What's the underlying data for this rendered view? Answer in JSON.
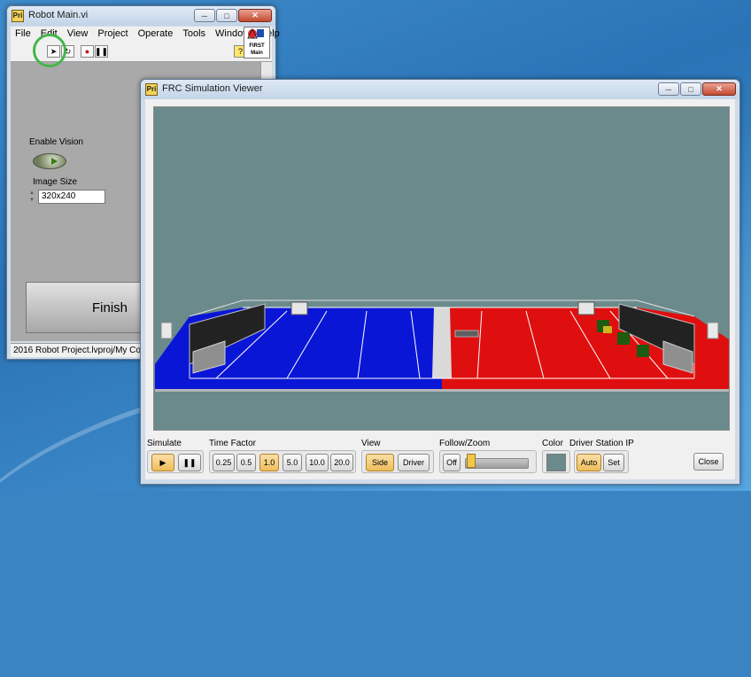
{
  "robot_window": {
    "icon_text": "Pri",
    "title": "Robot Main.vi",
    "menu": [
      "File",
      "Edit",
      "View",
      "Project",
      "Operate",
      "Tools",
      "Window",
      "Help"
    ],
    "logo_text": "FIRST Main",
    "enable_vision_label": "Enable Vision",
    "image_size_label": "Image Size",
    "image_size_value": "320x240",
    "finish_label": "Finish",
    "status_path": "2016 Robot Project.lvproj/My Comp"
  },
  "sim_window": {
    "icon_text": "Pri",
    "title": "FRC Simulation Viewer",
    "simulate": {
      "label": "Simulate"
    },
    "time_factor": {
      "label": "Time Factor",
      "options": [
        "0.25",
        "0.5",
        "1.0",
        "5.0",
        "10.0",
        "20.0"
      ],
      "selected": "1.0"
    },
    "view": {
      "label": "View",
      "options": [
        "Side",
        "Driver"
      ],
      "selected": "Side"
    },
    "follow_zoom": {
      "label": "Follow/Zoom",
      "follow_value": "Off"
    },
    "color": {
      "label": "Color"
    },
    "driver_station_ip": {
      "label": "Driver Station IP",
      "auto_label": "Auto",
      "set_label": "Set"
    },
    "close_label": "Close"
  },
  "colors": {
    "viewport_bg": "#6b8a8b",
    "field_blue": "#0a16d6",
    "field_red": "#e00f0f",
    "selected_button": "#efbd5c"
  }
}
